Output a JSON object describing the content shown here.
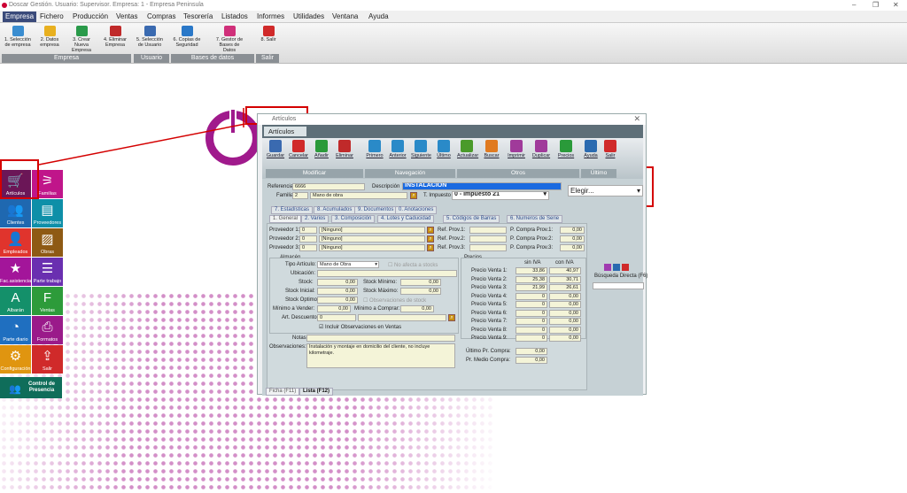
{
  "window_title": "Doscar Gestión. Usuario: Supervisor. Empresa: 1 - Empresa Peninsula",
  "menu": [
    "Empresa",
    "Fichero",
    "Producción",
    "Ventas",
    "Compras",
    "Tesorería",
    "Listados",
    "Informes",
    "Utilidades",
    "Ventana",
    "Ayuda"
  ],
  "ribbon": {
    "buttons": [
      "1. Selección de empresa",
      "2. Datos empresa",
      "3. Crear Nueva Empresa",
      "4. Eliminar Empresa",
      "5. Selección de Usuario",
      "6. Copias de Seguridad",
      "7. Gestor de Bases de Datos",
      "8. Salir"
    ],
    "groups": [
      "Empresa",
      "Usuario",
      "Bases de datos",
      "Salir"
    ]
  },
  "tiles": [
    {
      "label": "Artículos",
      "glyph": "🛒",
      "color": "#6b1657"
    },
    {
      "label": "Familias",
      "glyph": "⚞",
      "color": "#c0158a"
    },
    {
      "label": "Clientes",
      "glyph": "👥",
      "color": "#1f68b0"
    },
    {
      "label": "Proveedores",
      "glyph": "▤",
      "color": "#0e8fa8"
    },
    {
      "label": "Empleados",
      "glyph": "👤",
      "color": "#e0342d"
    },
    {
      "label": "Obras",
      "glyph": "▨",
      "color": "#8e5a14"
    },
    {
      "label": "Fac.asistencia",
      "glyph": "★",
      "color": "#a3159a"
    },
    {
      "label": "Parte trabajo",
      "glyph": "☰",
      "color": "#6a2fb0"
    },
    {
      "label": "Albarán",
      "glyph": "A",
      "color": "#14906a"
    },
    {
      "label": "Ventas",
      "glyph": "F",
      "color": "#2d9b3a"
    },
    {
      "label": "Parte diario",
      "glyph": "◔",
      "color": "#1f6fc0"
    },
    {
      "label": "Formatos",
      "glyph": "⎙",
      "color": "#9a1a8a"
    },
    {
      "label": "Configuración",
      "glyph": "⚙",
      "color": "#e09510"
    },
    {
      "label": "Salir",
      "glyph": "⇪",
      "color": "#d02a2a"
    }
  ],
  "presencia": "Control de Presencia",
  "art": {
    "window_title": "Artículos",
    "tab": "Artículos",
    "toolbar": [
      "Guardar",
      "Cancelar",
      "Añadir",
      "Eliminar",
      "Primero",
      "Anterior",
      "Siguiente",
      "Último",
      "Actualizar",
      "Buscar",
      "Imprimir",
      "Duplicar",
      "Precios",
      "Ayuda",
      "Salir"
    ],
    "groups": [
      "Modificar",
      "Navegación",
      "Otros",
      "Último"
    ],
    "referencia_label": "Referencia",
    "referencia": "6666",
    "descripcion_label": "Descripción",
    "descripcion": "INSTALACION",
    "familia_label": "Familia",
    "familia": "2",
    "familia_nombre": "Mano de obra",
    "impuesto_label": "T. Impuesto",
    "impuesto": "0 - Impuesto 21",
    "elegir": "Elegir...",
    "tabs_back": [
      "7. Estadísticas",
      "8. Acumulados",
      "9. Documentos",
      "0. Anotaciones"
    ],
    "tabs_front": [
      "1. General",
      "2. Varios",
      "3. Composición",
      "4. Lotes y Caducidad",
      "5. Códigos de Barras",
      "6. Numeros de Serie"
    ],
    "proveedores": [
      {
        "label": "Proveedor 1:",
        "code": "0",
        "name": "[Ninguno]",
        "ref": "Ref. Prov.1:",
        "pc": "P. Compra Prov.1:",
        "val": "0,00"
      },
      {
        "label": "Proveedor 2:",
        "code": "0",
        "name": "[Ninguno]",
        "ref": "Ref. Prov.2:",
        "pc": "P. Compra Prov.2:",
        "val": "0,00"
      },
      {
        "label": "Proveedor 3:",
        "code": "0",
        "name": "[Ninguno]",
        "ref": "Ref. Prov.3:",
        "pc": "P. Compra Prov.3:",
        "val": "0,00"
      }
    ],
    "almacen": "Almacén",
    "precios": "Precios",
    "tipo_label": "Tipo Artículo:",
    "tipo": "Mano de Obra",
    "no_stocks": "No afecta a stocks",
    "ubicacion": "Ubicación:",
    "stock_label": "Stock:",
    "stock": "0,00",
    "stock_min_label": "Stock Mínimo:",
    "stock_min": "0,00",
    "stock_ini_label": "Stock Inicial:",
    "stock_ini": "0,00",
    "stock_max_label": "Stock Máximo:",
    "stock_max": "0,00",
    "stock_opt_label": "Stock Optimo:",
    "stock_opt": "0,00",
    "obs_stock": "Observaciones de stock",
    "min_vender_label": "Mínimo a Vender:",
    "min_vender": "0,00",
    "min_comprar_label": "Mínimo a Comprar:",
    "min_comprar": "0,00",
    "art_desc_label": "Art. Descuento:",
    "art_desc": "0",
    "incluir_obs": "Incluir Observaciones en Ventas",
    "notas_label": "Notas:",
    "observaciones_label": "Observaciones:",
    "observaciones": "Instalación y montaje en domicilio del cliente, no incluye kilometraje.",
    "sin_iva": "sin IVA",
    "con_iva": "con IVA",
    "precios_venta": [
      {
        "label": "Precio Venta 1:",
        "sin": "33,86",
        "con": "40,97"
      },
      {
        "label": "Precio Venta 2:",
        "sin": "25,38",
        "con": "30,71"
      },
      {
        "label": "Precio Venta 3:",
        "sin": "21,99",
        "con": "26,61"
      },
      {
        "label": "Precio Venta 4:",
        "sin": "0",
        "con": "0,00"
      },
      {
        "label": "Precio Venta 5:",
        "sin": "0",
        "con": "0,00"
      },
      {
        "label": "Precio Venta 6:",
        "sin": "0",
        "con": "0,00"
      },
      {
        "label": "Precio Venta 7:",
        "sin": "0",
        "con": "0,00"
      },
      {
        "label": "Precio Venta 8:",
        "sin": "0",
        "con": "0,00"
      },
      {
        "label": "Precio Venta 9:",
        "sin": "0",
        "con": "0,00"
      }
    ],
    "ultimo_compra_label": "Último Pr. Compra:",
    "ultimo_compra": "0,00",
    "medio_compra_label": "Pr. Medio Compra:",
    "medio_compra": "0,00",
    "busqueda": "Búsqueda Directa (F6)",
    "ficha": "Ficha (F11)",
    "lista": "Lista (F12)"
  }
}
